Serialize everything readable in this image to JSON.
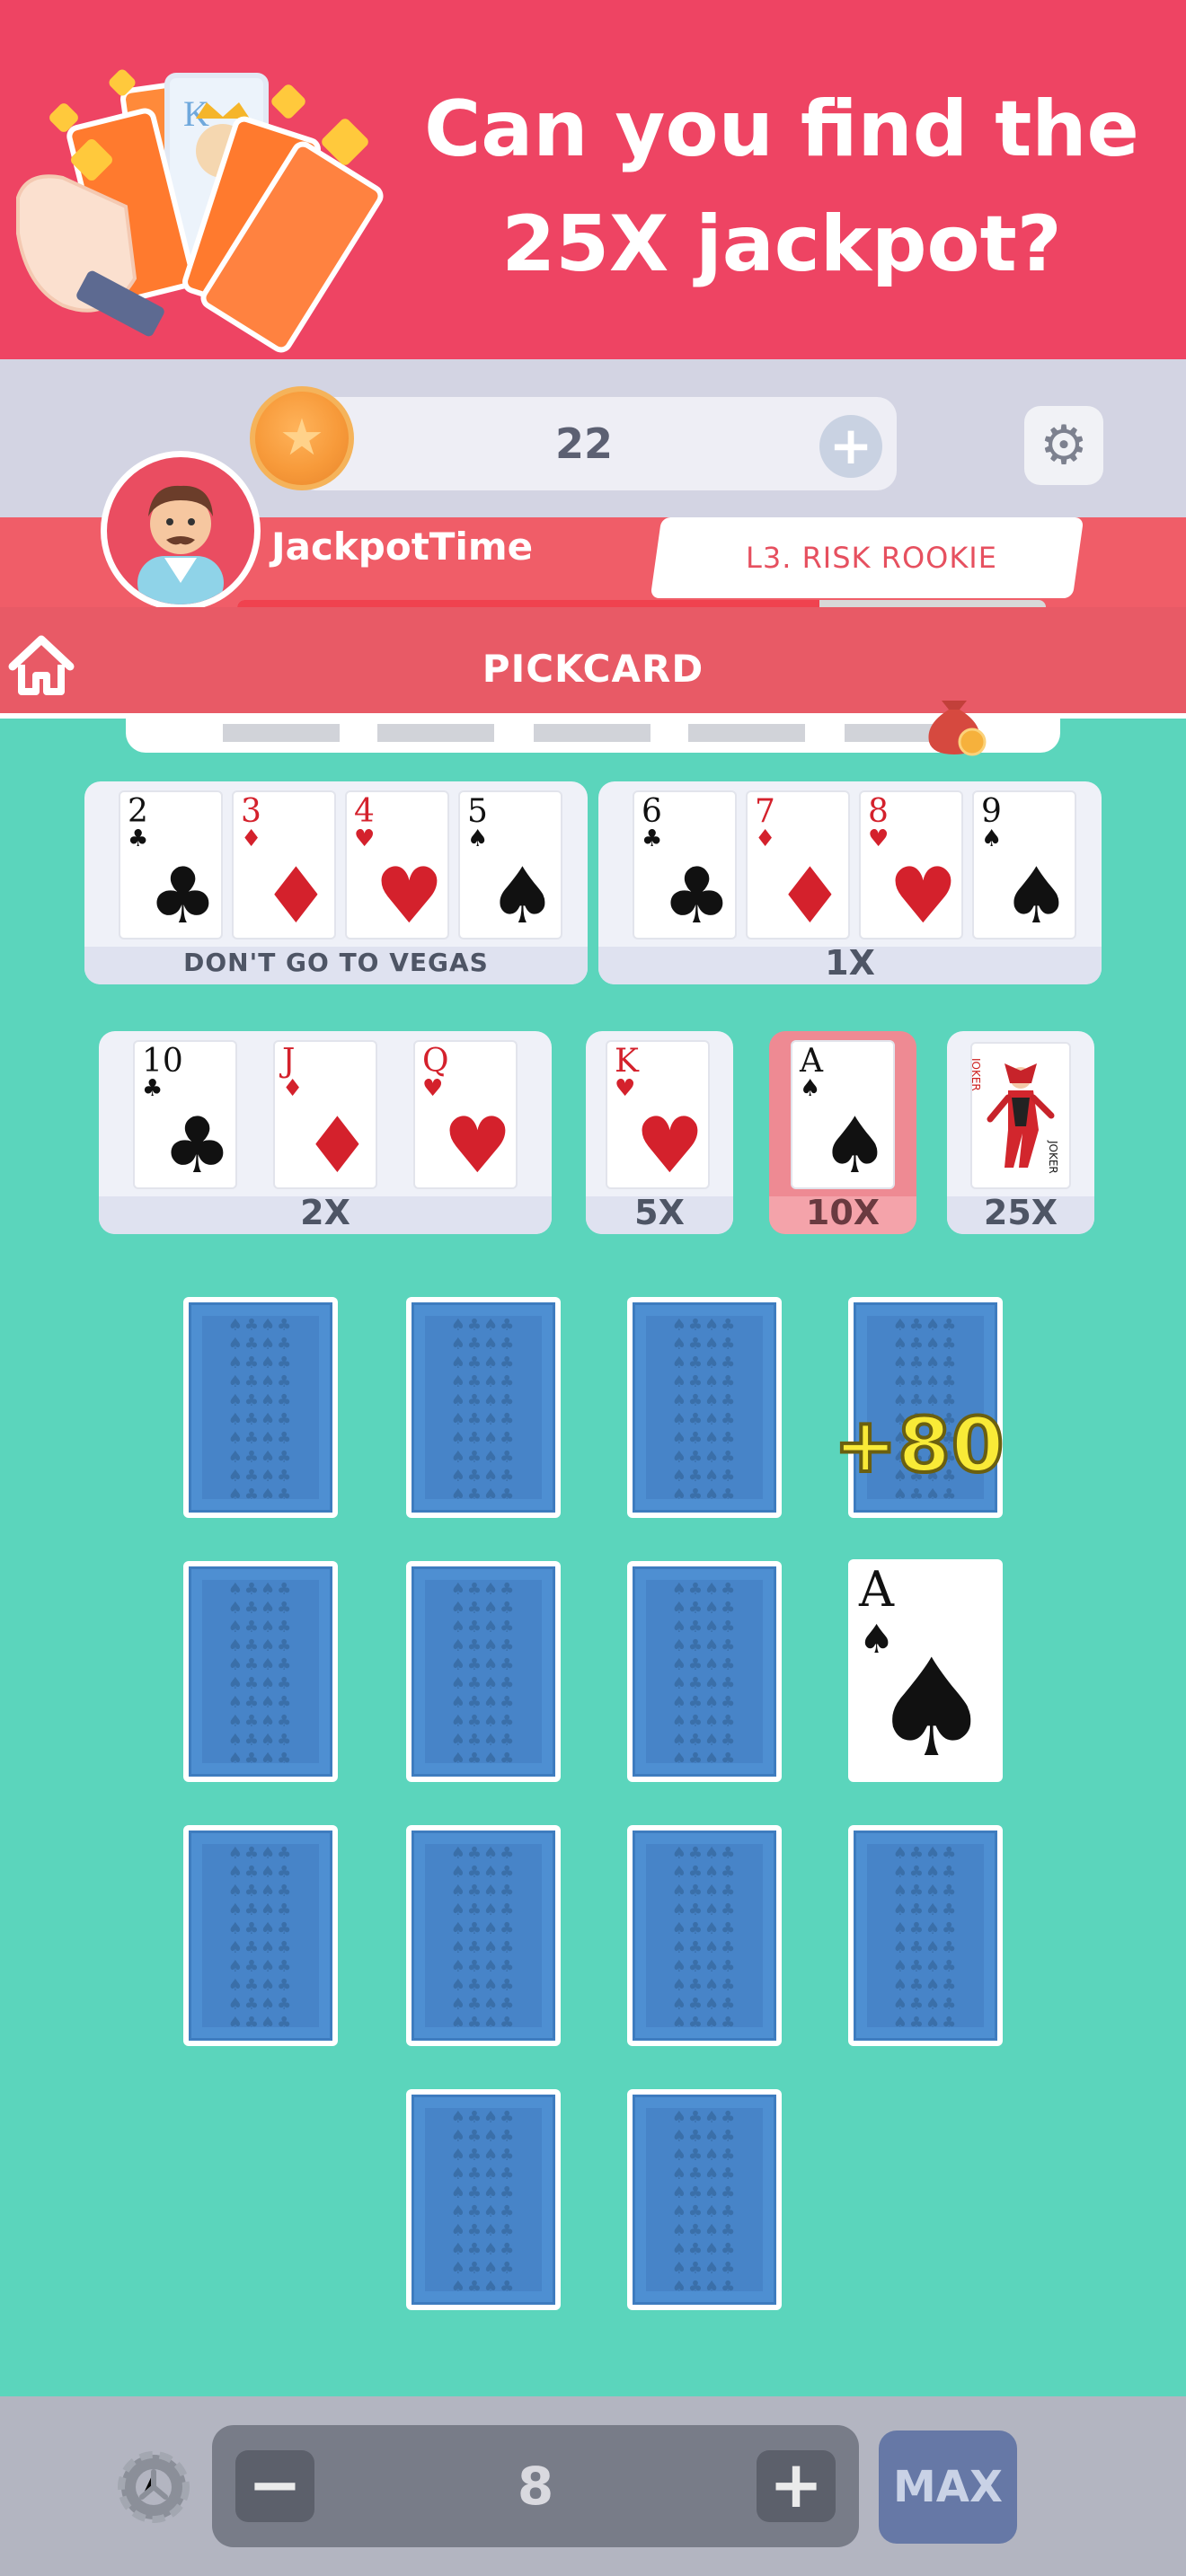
{
  "banner": {
    "title_line1": "Can you find the",
    "title_line2": "25X jackpot?"
  },
  "header": {
    "coins": "22",
    "coin_add_icon": "plus-icon",
    "settings_icon": "gear-icon"
  },
  "player": {
    "name": "JackpotTime",
    "level": "L3. RISK ROOKIE",
    "xp_progress": 0.72
  },
  "screen": {
    "title": "PICKCARD",
    "home_icon": "home-icon",
    "bonus_icon": "money-bag-icon",
    "tray_slots": 5
  },
  "paytable": {
    "group1": {
      "label": "DON'T GO TO VEGAS",
      "cards": [
        {
          "rank": "2",
          "suit": "♣",
          "color": "black"
        },
        {
          "rank": "3",
          "suit": "♦",
          "color": "red"
        },
        {
          "rank": "4",
          "suit": "♥",
          "color": "red"
        },
        {
          "rank": "5",
          "suit": "♠",
          "color": "black"
        }
      ]
    },
    "group2": {
      "label": "1X",
      "cards": [
        {
          "rank": "6",
          "suit": "♣",
          "color": "black"
        },
        {
          "rank": "7",
          "suit": "♦",
          "color": "red"
        },
        {
          "rank": "8",
          "suit": "♥",
          "color": "red"
        },
        {
          "rank": "9",
          "suit": "♠",
          "color": "black"
        }
      ]
    },
    "group3": {
      "label": "2X",
      "cards": [
        {
          "rank": "10",
          "suit": "♣",
          "color": "black"
        },
        {
          "rank": "J",
          "suit": "♦",
          "color": "red"
        },
        {
          "rank": "Q",
          "suit": "♥",
          "color": "red"
        }
      ]
    },
    "group4": {
      "label": "5X",
      "cards": [
        {
          "rank": "K",
          "suit": "♥",
          "color": "red"
        }
      ]
    },
    "group5": {
      "label": "10X",
      "highlighted": true,
      "cards": [
        {
          "rank": "A",
          "suit": "♠",
          "color": "black"
        }
      ]
    },
    "group6": {
      "label": "25X",
      "card": "joker"
    }
  },
  "board": {
    "revealed_card": {
      "rank": "A",
      "suit": "♠"
    },
    "win_popup": "+80",
    "face_down_cards": 13
  },
  "bet": {
    "value": "8",
    "minus_label": "−",
    "plus_label": "+",
    "max_label": "MAX"
  },
  "colors": {
    "banner": "#ee4463",
    "felt": "#5bd5bc",
    "card_back": "#4e8fd2",
    "highlight": "#ee8a93"
  }
}
